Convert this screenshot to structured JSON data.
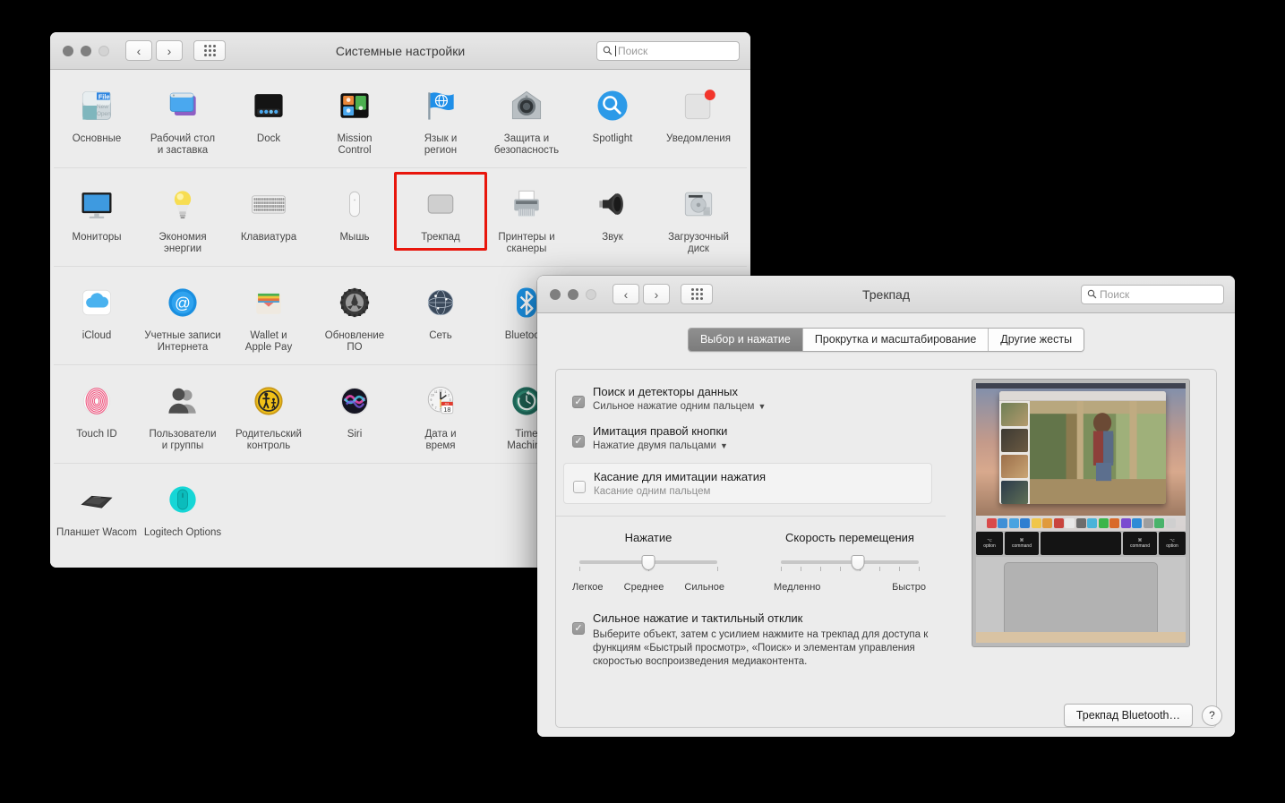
{
  "system_prefs": {
    "title": "Системные настройки",
    "search": {
      "placeholder": "Поиск",
      "value": ""
    },
    "nav": {
      "back": "‹",
      "forward": "›",
      "grid": "grid-icon"
    },
    "rows": [
      {
        "items": [
          {
            "label": "Основные",
            "icon": "general-icon"
          },
          {
            "label": "Рабочий стол\nи заставка",
            "icon": "desktop-screensaver-icon"
          },
          {
            "label": "Dock",
            "icon": "dock-icon"
          },
          {
            "label": "Mission\nControl",
            "icon": "mission-control-icon"
          },
          {
            "label": "Язык и\nрегион",
            "icon": "language-region-icon"
          },
          {
            "label": "Защита и\nбезопасность",
            "icon": "security-privacy-icon"
          },
          {
            "label": "Spotlight",
            "icon": "spotlight-icon"
          },
          {
            "label": "Уведомления",
            "icon": "notifications-icon",
            "badge": true
          }
        ]
      },
      {
        "items": [
          {
            "label": "Мониторы",
            "icon": "displays-icon"
          },
          {
            "label": "Экономия\nэнергии",
            "icon": "energy-saver-icon"
          },
          {
            "label": "Клавиатура",
            "icon": "keyboard-icon"
          },
          {
            "label": "Мышь",
            "icon": "mouse-icon"
          },
          {
            "label": "Трекпад",
            "icon": "trackpad-icon",
            "highlighted": true
          },
          {
            "label": "Принтеры и\nсканеры",
            "icon": "printers-scanners-icon"
          },
          {
            "label": "Звук",
            "icon": "sound-icon"
          },
          {
            "label": "Загрузочный\nдиск",
            "icon": "startup-disk-icon"
          }
        ]
      },
      {
        "items": [
          {
            "label": "iCloud",
            "icon": "icloud-icon"
          },
          {
            "label": "Учетные записи\nИнтернета",
            "icon": "internet-accounts-icon"
          },
          {
            "label": "Wallet и\nApple Pay",
            "icon": "wallet-applepay-icon"
          },
          {
            "label": "Обновление\nПО",
            "icon": "software-update-icon"
          },
          {
            "label": "Сеть",
            "icon": "network-icon"
          },
          {
            "label": "Bluetooth",
            "icon": "bluetooth-icon"
          },
          {
            "label": "",
            "icon": ""
          },
          {
            "label": "",
            "icon": ""
          }
        ]
      },
      {
        "items": [
          {
            "label": "Touch ID",
            "icon": "touch-id-icon"
          },
          {
            "label": "Пользователи\nи группы",
            "icon": "users-groups-icon"
          },
          {
            "label": "Родительский\nконтроль",
            "icon": "parental-controls-icon"
          },
          {
            "label": "Siri",
            "icon": "siri-icon"
          },
          {
            "label": "Дата и\nвремя",
            "icon": "date-time-icon"
          },
          {
            "label": "Time\nMachine",
            "icon": "time-machine-icon"
          },
          {
            "label": "",
            "icon": ""
          },
          {
            "label": "",
            "icon": ""
          }
        ]
      },
      {
        "items": [
          {
            "label": "Планшет Wacom",
            "icon": "wacom-tablet-icon"
          },
          {
            "label": "Logitech Options",
            "icon": "logitech-options-icon"
          }
        ]
      }
    ]
  },
  "trackpad": {
    "title": "Трекпад",
    "search": {
      "placeholder": "Поиск",
      "value": ""
    },
    "tabs": [
      {
        "label": "Выбор и нажатие",
        "active": true
      },
      {
        "label": "Прокрутка и масштабирование",
        "active": false
      },
      {
        "label": "Другие жесты",
        "active": false
      }
    ],
    "options": [
      {
        "title": "Поиск и детекторы данных",
        "sub": "Сильное нажатие одним пальцем",
        "has_popup": true,
        "checked": true,
        "hovered": false
      },
      {
        "title": "Имитация правой кнопки",
        "sub": "Нажатие двумя пальцами",
        "has_popup": true,
        "checked": true,
        "hovered": false
      },
      {
        "title": "Касание для имитации нажатия",
        "sub": "Касание одним пальцем",
        "has_popup": false,
        "checked": false,
        "hovered": true
      }
    ],
    "sliders": [
      {
        "title": "Нажатие",
        "labels": [
          "Легкое",
          "Среднее",
          "Сильное"
        ],
        "position_pct": 50,
        "ticks": 3
      },
      {
        "title": "Скорость перемещения",
        "labels": [
          "Медленно",
          "Быстро"
        ],
        "position_pct": 55,
        "ticks": 8
      }
    ],
    "force_click": {
      "title": "Сильное нажатие и тактильный отклик",
      "checked": true,
      "description": "Выберите объект, затем с усилием нажмите на трекпад для доступа к функциям «Быстрый просмотр», «Поиск» и элементам управления скоростью воспроизведения медиаконтента."
    },
    "footer": {
      "bluetooth_button": "Трекпад Bluetooth…",
      "help_button": "?"
    },
    "preview": {
      "keys": [
        "option",
        "command",
        "",
        "command",
        "option"
      ]
    }
  },
  "annotation": {
    "highlight_color": "#e8160c"
  }
}
